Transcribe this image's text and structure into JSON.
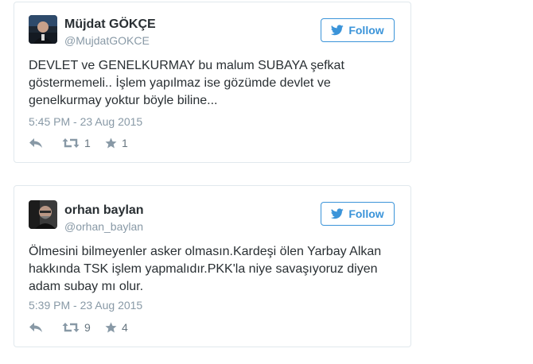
{
  "tweets": [
    {
      "display_name": "Müjdat GÖKÇE",
      "screen_name": "@MujdatGOKCE",
      "follow_label": "Follow",
      "text_lines": [
        "DEVLET ve GENELKURMAY bu malum SUBAYA şefkat",
        "göstermemeli.. İşlem yapılmaz ise gözümde devlet ve",
        "genelkurmay yoktur böyle biline..."
      ],
      "timestamp": "5:45 PM - 23 Aug 2015",
      "retweets": "1",
      "favorites": "1",
      "icons": {
        "follow": "twitter-bird-icon",
        "reply": "reply-icon",
        "retweet": "retweet-icon",
        "favorite": "star-icon"
      }
    },
    {
      "display_name": "orhan baylan",
      "screen_name": "@orhan_baylan",
      "follow_label": "Follow",
      "text_lines": [
        "Ölmesini bilmeyenler asker olmasın.Kardeşi ölen Yarbay Alkan",
        "hakkında TSK işlem yapmalıdır.PKK'la niye savaşıyoruz diyen",
        "adam subay mı olur."
      ],
      "timestamp": "5:39 PM - 23 Aug 2015",
      "retweets": "9",
      "favorites": "4",
      "icons": {
        "follow": "twitter-bird-icon",
        "reply": "reply-icon",
        "retweet": "retweet-icon",
        "favorite": "star-icon"
      }
    }
  ],
  "colors": {
    "accent": "#3b94d9",
    "text": "#292f33",
    "muted": "#8899a6",
    "border": "#e1e8ed"
  }
}
